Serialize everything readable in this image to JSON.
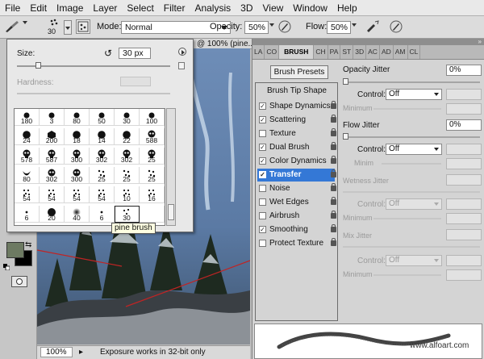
{
  "menu": [
    "File",
    "Edit",
    "Image",
    "Layer",
    "Select",
    "Filter",
    "Analysis",
    "3D",
    "View",
    "Window",
    "Help"
  ],
  "options_bar": {
    "brush_size": "30",
    "mode_label": "Mode:",
    "mode_value": "Normal",
    "opacity_label": "Opacity:",
    "opacity_value": "50%",
    "flow_label": "Flow:",
    "flow_value": "50%"
  },
  "document_tab": "@ 100% (pine...",
  "picker": {
    "size_label": "Size:",
    "size_value": "30 px",
    "hardness_label": "Hardness:",
    "tooltip": "pine brush",
    "size_level": 0.12,
    "grid": [
      [
        "180",
        "3",
        "80",
        "50",
        "30",
        "100"
      ],
      [
        "24",
        "200",
        "18",
        "14",
        "22",
        "588"
      ],
      [
        "578",
        "587",
        "300",
        "302",
        "302",
        "25"
      ],
      [
        "80",
        "302",
        "300",
        "25",
        "25",
        "25"
      ],
      [
        "54",
        "54",
        "54",
        "54",
        "10",
        "16"
      ],
      [
        "6",
        "20",
        "40",
        "6",
        "30",
        ""
      ]
    ]
  },
  "tools": {
    "foreground_color": "#6d7a62",
    "background_color": "#000000"
  },
  "status": {
    "zoom": "100%",
    "message": "Exposure works in 32-bit only"
  },
  "panel": {
    "tabs": [
      "LA",
      "CO",
      "BRUSH",
      "CH",
      "PA",
      "ST",
      "3D",
      "AC",
      "AD",
      "AM",
      "CL"
    ],
    "active_tab": "BRUSH",
    "presets_button": "Brush Presets",
    "list_header": "Brush Tip Shape",
    "items": [
      {
        "label": "Shape Dynamics",
        "checked": true,
        "selected": false
      },
      {
        "label": "Scattering",
        "checked": true,
        "selected": false
      },
      {
        "label": "Texture",
        "checked": false,
        "selected": false
      },
      {
        "label": "Dual Brush",
        "checked": true,
        "selected": false
      },
      {
        "label": "Color Dynamics",
        "checked": true,
        "selected": false
      },
      {
        "label": "Transfer",
        "checked": true,
        "selected": true
      },
      {
        "label": "Noise",
        "checked": false,
        "selected": false
      },
      {
        "label": "Wet Edges",
        "checked": false,
        "selected": false
      },
      {
        "label": "Airbrush",
        "checked": false,
        "selected": false
      },
      {
        "label": "Smoothing",
        "checked": true,
        "selected": false
      },
      {
        "label": "Protect Texture",
        "checked": false,
        "selected": false
      }
    ],
    "opacity_jitter": {
      "label": "Opacity Jitter",
      "value": "0%",
      "control_label": "Control:",
      "control_value": "Off",
      "minimum_label": "Minimum"
    },
    "flow_jitter": {
      "label": "Flow Jitter",
      "value": "0%",
      "control_label": "Control:",
      "control_value": "Off",
      "minimum_label": "Minim"
    },
    "wetness_jitter": {
      "label": "Wetness Jitter",
      "control_label": "Control:",
      "control_value": "Off",
      "minimum_label": "Minimum"
    },
    "mix_jitter": {
      "label": "Mix Jitter",
      "control_label": "Control:",
      "control_value": "Off",
      "minimum_label": "Minimum"
    }
  },
  "watermark": "www.alfoart.com",
  "colors": {
    "accent_selection": "#3478d6",
    "canvas_sky": "#5f7ea7"
  }
}
